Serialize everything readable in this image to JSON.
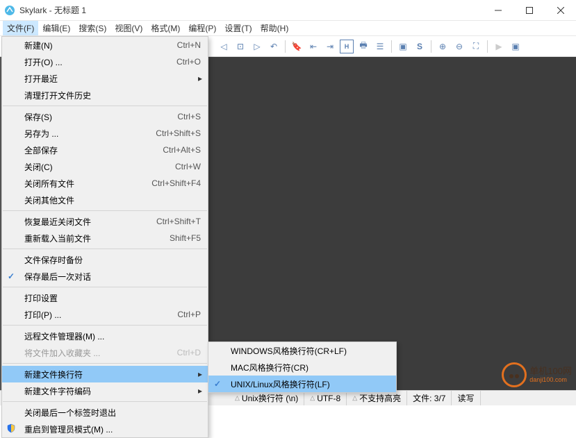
{
  "window": {
    "title": "Skylark - 无标题 1"
  },
  "menubar": [
    "文件(F)",
    "编辑(E)",
    "搜索(S)",
    "视图(V)",
    "格式(M)",
    "编程(P)",
    "设置(T)",
    "帮助(H)"
  ],
  "file_menu": [
    {
      "type": "item",
      "label": "新建(N)",
      "shortcut": "Ctrl+N"
    },
    {
      "type": "item",
      "label": "打开(O) ...",
      "shortcut": "Ctrl+O"
    },
    {
      "type": "item",
      "label": "打开最近",
      "submenu": true
    },
    {
      "type": "item",
      "label": "清理打开文件历史"
    },
    {
      "type": "sep"
    },
    {
      "type": "item",
      "label": "保存(S)",
      "shortcut": "Ctrl+S"
    },
    {
      "type": "item",
      "label": "另存为 ...",
      "shortcut": "Ctrl+Shift+S"
    },
    {
      "type": "item",
      "label": "全部保存",
      "shortcut": "Ctrl+Alt+S"
    },
    {
      "type": "item",
      "label": "关闭(C)",
      "shortcut": "Ctrl+W"
    },
    {
      "type": "item",
      "label": "关闭所有文件",
      "shortcut": "Ctrl+Shift+F4"
    },
    {
      "type": "item",
      "label": "关闭其他文件"
    },
    {
      "type": "sep"
    },
    {
      "type": "item",
      "label": "恢复最近关闭文件",
      "shortcut": "Ctrl+Shift+T"
    },
    {
      "type": "item",
      "label": "重新载入当前文件",
      "shortcut": "Shift+F5"
    },
    {
      "type": "sep"
    },
    {
      "type": "item",
      "label": "文件保存时备份"
    },
    {
      "type": "item",
      "label": "保存最后一次对话",
      "checked": true
    },
    {
      "type": "sep"
    },
    {
      "type": "item",
      "label": "打印设置"
    },
    {
      "type": "item",
      "label": "打印(P) ...",
      "shortcut": "Ctrl+P"
    },
    {
      "type": "sep"
    },
    {
      "type": "item",
      "label": "远程文件管理器(M) ..."
    },
    {
      "type": "item",
      "label": "将文件加入收藏夹 ...",
      "shortcut": "Ctrl+D",
      "disabled": true
    },
    {
      "type": "sep"
    },
    {
      "type": "item",
      "label": "新建文件换行符",
      "submenu": true,
      "highlight": true
    },
    {
      "type": "item",
      "label": "新建文件字符编码",
      "submenu": true
    },
    {
      "type": "sep"
    },
    {
      "type": "item",
      "label": "关闭最后一个标签时退出"
    },
    {
      "type": "item",
      "label": "重启到管理员模式(M) ...",
      "shield": true
    }
  ],
  "submenu_eol": [
    {
      "label": "WINDOWS风格换行符(CR+LF)"
    },
    {
      "label": "MAC风格换行符(CR)"
    },
    {
      "label": "UNIX/Linux风格换行符(LF)",
      "checked": true,
      "highlight": true
    }
  ],
  "statusbar": {
    "eol": "Unix换行符 (\\n)",
    "encoding": "UTF-8",
    "highlight": "不支持高亮",
    "fileinfo": "文件: 3/7",
    "mode": "读写"
  },
  "watermark": {
    "name": "单机100网",
    "url": "danji100.com"
  }
}
